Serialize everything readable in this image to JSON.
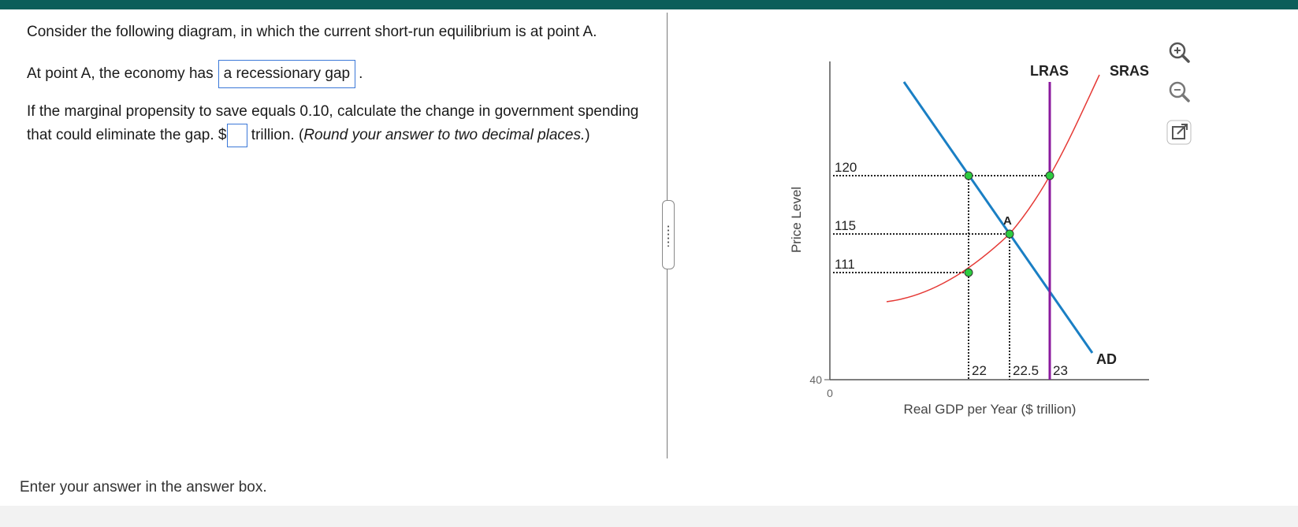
{
  "header": {
    "color": "#0b5e5a"
  },
  "question": {
    "line1": "Consider the following diagram, in which the current short-run equilibrium is at point A.",
    "line2_prefix": "At point A, the economy has",
    "line2_answer": "a recessionary gap",
    "line2_suffix": ".",
    "line3": "If the marginal propensity to save equals 0.10, calculate the change in government spending",
    "line4_prefix": "that could eliminate the gap. $",
    "line4_mid": " trillion. (",
    "line4_italic": "Round your answer to two decimal places.",
    "line4_end": ")"
  },
  "footer": {
    "instruction": "Enter your answer in the answer box."
  },
  "tools": {
    "zoom_in": "zoom-in-icon",
    "zoom_out": "zoom-out-icon",
    "popout": "popout-icon"
  },
  "graph": {
    "y_axis_label": "Price Level",
    "x_axis_label": "Real GDP per Year ($ trillion)",
    "origin_label": "0",
    "y_axis_bottom": "40",
    "price_ticks": [
      "120",
      "115",
      "111"
    ],
    "gdp_ticks": [
      "22",
      "22.5",
      "23"
    ],
    "curve_labels": {
      "lras": "LRAS",
      "sras": "SRAS",
      "ad": "AD"
    },
    "point_label": "A",
    "colors": {
      "ad": "#1a7fc4",
      "sras": "#e53935",
      "lras": "#8b1a9e",
      "points": "#2ecc40"
    }
  }
}
